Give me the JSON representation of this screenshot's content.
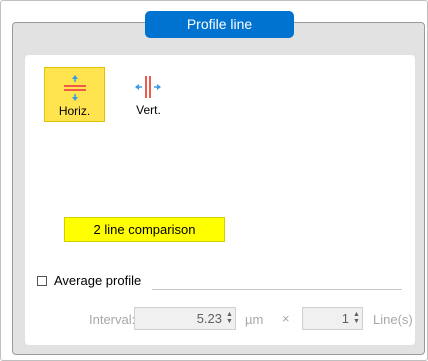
{
  "group": {
    "title": "Profile line"
  },
  "modes": [
    {
      "label": "Horiz.",
      "active": true,
      "icon": "horizontal-line-icon"
    },
    {
      "label": "Vert.",
      "active": false,
      "icon": "vertical-line-icon"
    }
  ],
  "compare_button": {
    "label": "2 line comparison"
  },
  "average": {
    "checkbox_checked": false,
    "label": "Average profile",
    "interval_label": "Interval:",
    "interval_value": "5.23",
    "unit": "µm",
    "times": "×",
    "lines_value": "1",
    "lines_label": "Line(s)"
  },
  "colors": {
    "accent": "#0073d1",
    "active_mode": "#ffe34f",
    "compare_button": "#ffff00",
    "arrow": "#3a9be8",
    "line": "#ef5a4a"
  }
}
